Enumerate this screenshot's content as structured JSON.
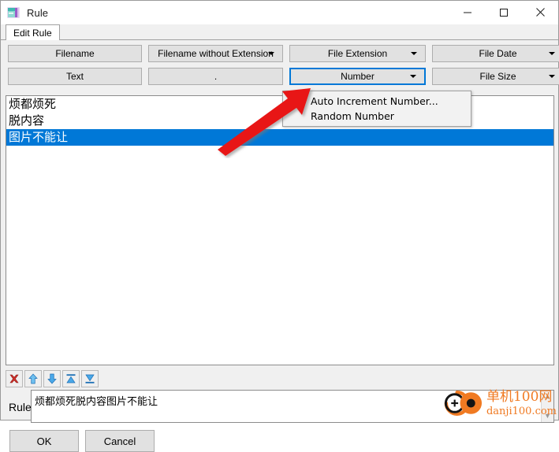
{
  "window": {
    "title": "Rule",
    "icon": "app-rule-icon",
    "controls": {
      "minimize": "—",
      "maximize": "□",
      "close": "✕"
    }
  },
  "tabs": [
    {
      "label": "Edit Rule",
      "active": true
    }
  ],
  "buttons": {
    "row1": [
      {
        "label": "Filename",
        "type": "button",
        "name": "filename-button"
      },
      {
        "label": "Filename without Extension",
        "type": "dropdown",
        "name": "filename-without-extension-button"
      },
      {
        "label": "File Extension",
        "type": "dropdown",
        "name": "file-extension-button"
      },
      {
        "label": "File Date",
        "type": "dropdown",
        "name": "file-date-button"
      }
    ],
    "row2": [
      {
        "label": "Text",
        "type": "button",
        "name": "text-button"
      },
      {
        "label": ".",
        "type": "button",
        "name": "dot-button"
      },
      {
        "label": "Number",
        "type": "dropdown",
        "name": "number-button",
        "selected": true
      },
      {
        "label": "File Size",
        "type": "dropdown",
        "name": "file-size-button"
      }
    ]
  },
  "dropdown_menu": {
    "open": true,
    "items": [
      {
        "label": "Auto Increment Number..."
      },
      {
        "label": "Random Number"
      }
    ]
  },
  "list": {
    "rows": [
      {
        "text": "烦都烦死",
        "selected": false
      },
      {
        "text": "脱内容",
        "selected": false
      },
      {
        "text": "图片不能让",
        "selected": true
      }
    ]
  },
  "toolbar": {
    "items": [
      {
        "name": "delete-icon",
        "glyph": "✖",
        "color": "#c0392b"
      },
      {
        "name": "move-up-icon",
        "glyph": "⬆",
        "color": "#2f86d6"
      },
      {
        "name": "move-down-icon",
        "glyph": "⬇",
        "color": "#2f86d6"
      },
      {
        "name": "move-to-top-icon",
        "glyph": "⏫",
        "color": "#2f86d6"
      },
      {
        "name": "move-to-bottom-icon",
        "glyph": "⏬",
        "color": "#2f86d6"
      }
    ]
  },
  "rule": {
    "label": "Rule:",
    "value": "烦都烦死脱内容图片不能让",
    "placeholder": ""
  },
  "footer": {
    "ok": "OK",
    "cancel": "Cancel"
  },
  "watermark": {
    "cn": "单机100网",
    "url": "danji100.com",
    "color": "#f07a22"
  },
  "colors": {
    "selection_blue": "#0078d7",
    "button_face": "#e1e1e1",
    "window_face": "#f0f0f0",
    "accent_orange": "#f07a22",
    "annotation_red": "#e01010"
  }
}
